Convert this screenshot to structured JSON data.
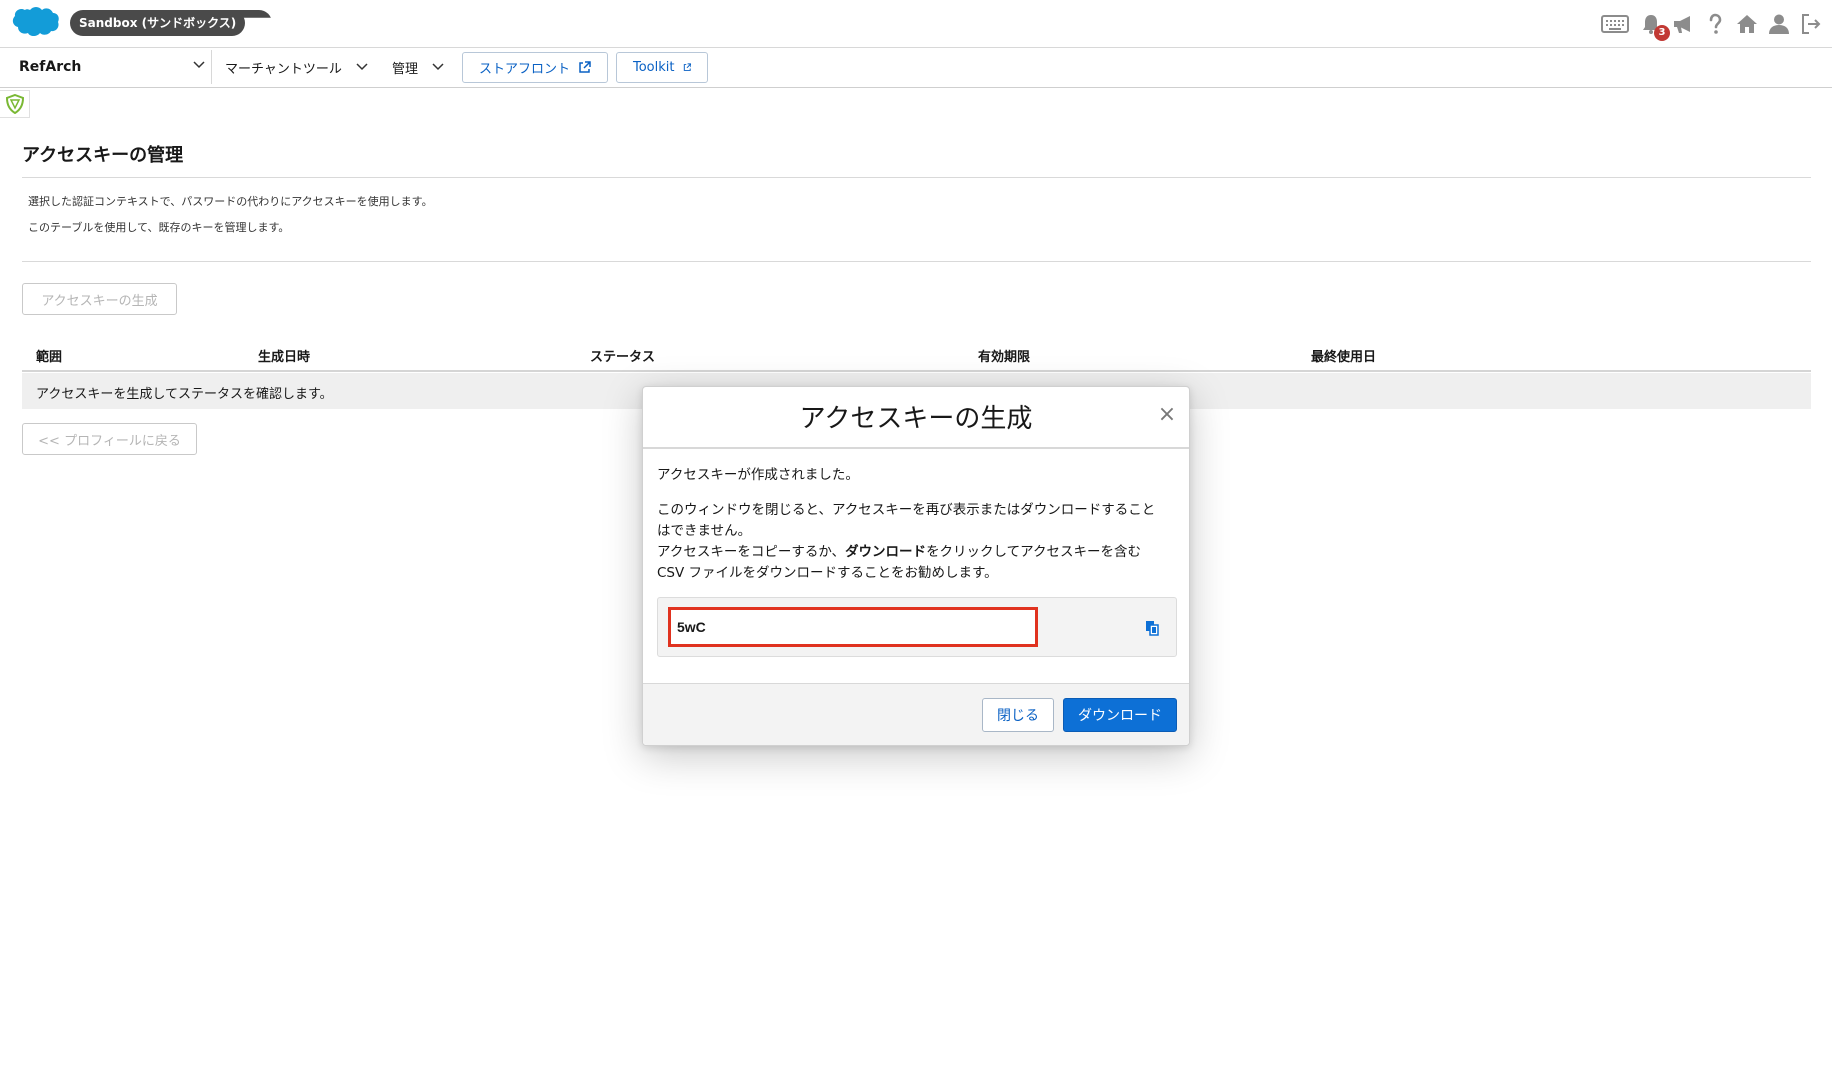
{
  "header": {
    "sandbox_label": "Sandbox (サンドボックス)",
    "notification_count": "3",
    "icons": [
      "keyboard-icon",
      "bell-icon",
      "megaphone-icon",
      "help-icon",
      "home-icon",
      "user-icon",
      "logout-icon"
    ]
  },
  "nav": {
    "site_name": "RefArch",
    "menu_merchant_tools": "マーチャントツール",
    "menu_admin": "管理",
    "link_storefront": "ストアフロント",
    "link_toolkit": "Toolkit"
  },
  "page": {
    "title": "アクセスキーの管理",
    "desc_line1": "選択した認証コンテキストで、パスワードの代わりにアクセスキーを使用します。",
    "desc_line2": "このテーブルを使用して、既存のキーを管理します。",
    "generate_button": "アクセスキーの生成",
    "back_button": "<< プロフィールに戻る"
  },
  "table": {
    "columns": [
      "範囲",
      "生成日時",
      "ステータス",
      "有効期限",
      "最終使用日"
    ],
    "empty_message": "アクセスキーを生成してステータスを確認します。"
  },
  "modal": {
    "title": "アクセスキーの生成",
    "close_glyph": "×",
    "message_created": "アクセスキーが作成されました。",
    "warning_line1": "このウィンドウを閉じると、アクセスキーを再び表示またはダウンロードすること",
    "warning_line2": "はできません。",
    "advice_pre": "アクセスキーをコピーするか、",
    "advice_bold": "ダウンロード",
    "advice_post": "をクリックしてアクセスキーを含む",
    "advice_line2": "CSV ファイルをダウンロードすることをお勧めします。",
    "access_key_value": "5wC",
    "close_button": "閉じる",
    "download_button": "ダウンロード"
  },
  "colors": {
    "brand_blue": "#0d70d6",
    "link_blue": "#0a61c4",
    "highlight_red": "#e0321f",
    "badge_red": "#c23934"
  }
}
